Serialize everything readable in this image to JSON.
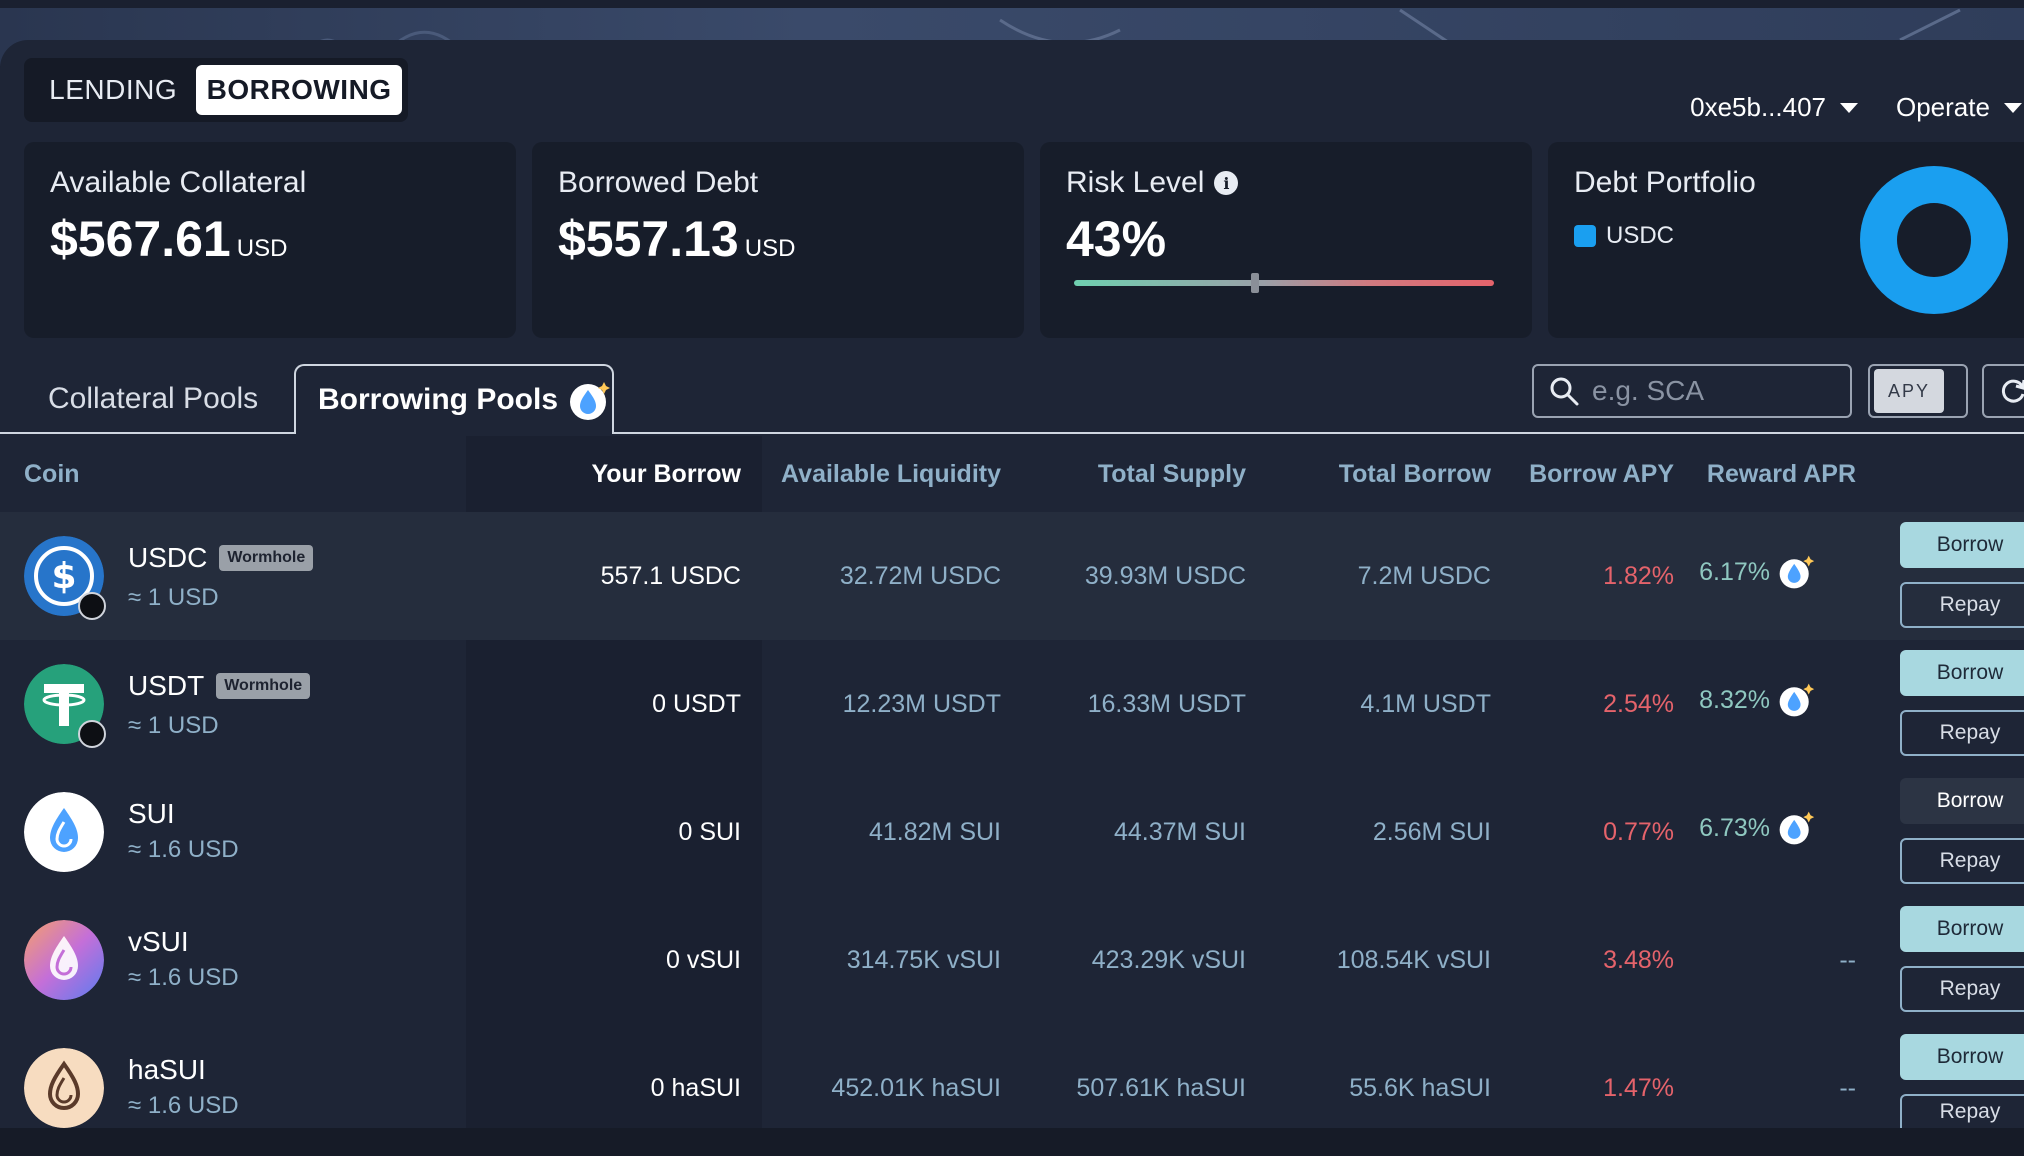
{
  "header": {
    "modes": [
      "LENDING",
      "BORROWING"
    ],
    "wallet": "0xe5b...407",
    "operate": "Operate"
  },
  "cards": {
    "collateral": {
      "label": "Available Collateral",
      "value": "$567.61",
      "unit": "USD"
    },
    "debt": {
      "label": "Borrowed Debt",
      "value": "$557.13",
      "unit": "USD"
    },
    "risk": {
      "label": "Risk Level",
      "value": "43%",
      "level_fraction": 0.43
    },
    "portfolio": {
      "label": "Debt Portfolio",
      "legend": "USDC",
      "legend_color": "#1a9ff0"
    }
  },
  "tabs": {
    "collateral": "Collateral Pools",
    "borrowing": "Borrowing Pools"
  },
  "toolbar": {
    "search_placeholder": "e.g. SCA",
    "apy_label": "APY"
  },
  "table": {
    "headers": [
      "Coin",
      "Your Borrow",
      "Available Liquidity",
      "Total Supply",
      "Total Borrow",
      "Borrow APY",
      "Reward APR"
    ],
    "borrow_label": "Borrow",
    "repay_label": "Repay",
    "rows": [
      {
        "coin": "USDC",
        "tag": "Wormhole",
        "price": "≈ 1 USD",
        "your_borrow": "557.1 USDC",
        "liquidity": "32.72M USDC",
        "supply": "39.93M USDC",
        "borrow": "7.2M USDC",
        "apy": "1.82%",
        "apr": "6.17%"
      },
      {
        "coin": "USDT",
        "tag": "Wormhole",
        "price": "≈ 1 USD",
        "your_borrow": "0 USDT",
        "liquidity": "12.23M USDT",
        "supply": "16.33M USDT",
        "borrow": "4.1M USDT",
        "apy": "2.54%",
        "apr": "8.32%"
      },
      {
        "coin": "SUI",
        "tag": "",
        "price": "≈ 1.6 USD",
        "your_borrow": "0 SUI",
        "liquidity": "41.82M SUI",
        "supply": "44.37M SUI",
        "borrow": "2.56M SUI",
        "apy": "0.77%",
        "apr": "6.73%"
      },
      {
        "coin": "vSUI",
        "tag": "",
        "price": "≈ 1.6 USD",
        "your_borrow": "0 vSUI",
        "liquidity": "314.75K vSUI",
        "supply": "423.29K vSUI",
        "borrow": "108.54K vSUI",
        "apy": "3.48%",
        "apr": "--"
      },
      {
        "coin": "haSUI",
        "tag": "",
        "price": "≈ 1.6 USD",
        "your_borrow": "0 haSUI",
        "liquidity": "452.01K haSUI",
        "supply": "507.61K haSUI",
        "borrow": "55.6K haSUI",
        "apy": "1.47%",
        "apr": "--"
      }
    ]
  }
}
